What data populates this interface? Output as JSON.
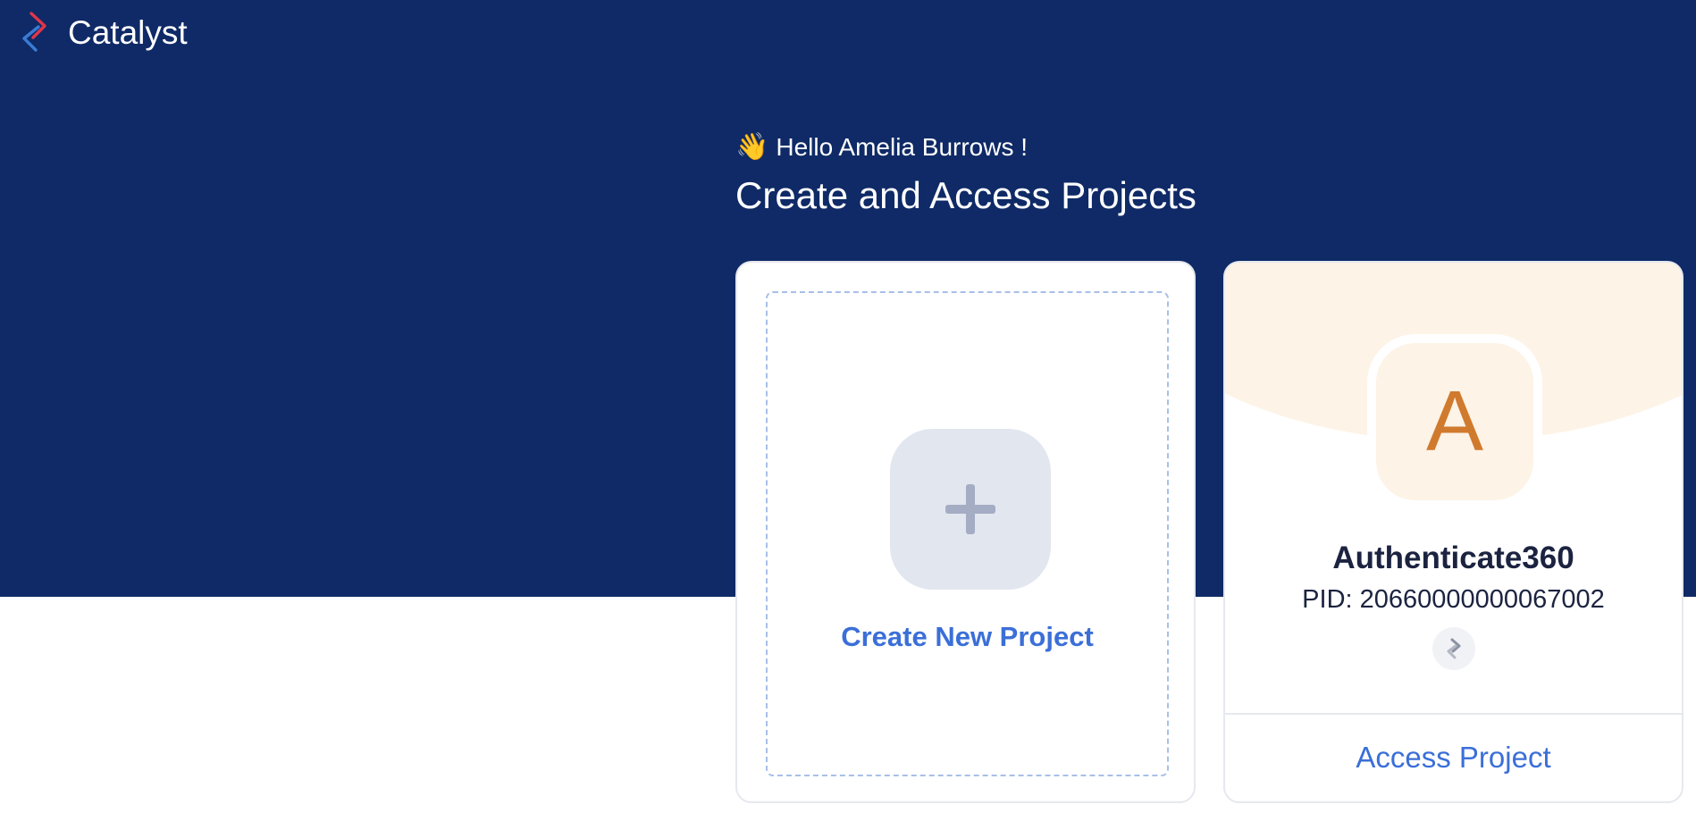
{
  "header": {
    "brand_name": "Catalyst",
    "brand_icon": "catalyst-logo-icon"
  },
  "greeting": {
    "icon": "waving-hand-icon",
    "emoji": "👋",
    "text": "Hello Amelia Burrows !"
  },
  "page": {
    "title": "Create and Access Projects"
  },
  "create_card": {
    "icon": "plus-icon",
    "label": "Create New Project"
  },
  "project_card": {
    "avatar_letter": "A",
    "name": "Authenticate360",
    "pid": "PID: 20660000000067002",
    "service_icon": "catalyst-service-icon",
    "action_label": "Access Project"
  },
  "colors": {
    "hero_background": "#0f2a66",
    "accent_blue": "#3b6fd8",
    "avatar_orange": "#d07a2e",
    "avatar_background": "#fdf3e7",
    "logo_red": "#e0364a",
    "logo_blue": "#3a7bd5"
  }
}
